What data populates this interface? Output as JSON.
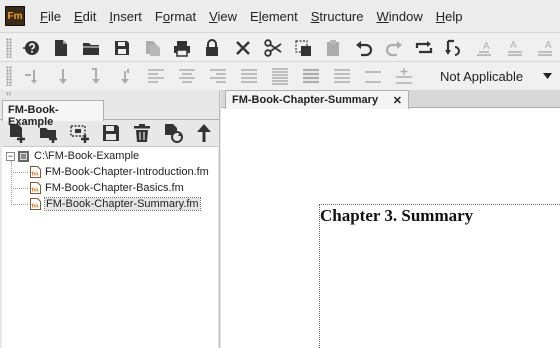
{
  "app": {
    "logo_text": "Fm"
  },
  "menu": [
    "File",
    "Edit",
    "Insert",
    "Format",
    "View",
    "Element",
    "Structure",
    "Window",
    "Help"
  ],
  "menu_underline": [
    "F",
    "E",
    "I",
    "o",
    "V",
    "l",
    "S",
    "W",
    "H"
  ],
  "toolbar1_icons": [
    "help-icon",
    "new-file-icon",
    "open-folder-icon",
    "save-icon",
    "copy-file-icon",
    "print-icon",
    "lock-icon",
    "close-x-icon",
    "cut-icon",
    "copy-selection-icon",
    "paste-icon",
    "undo-icon",
    "redo-icon",
    "repeat-icon",
    "reverse-sort-icon",
    "text-style-a-icon",
    "text-style-a2-icon",
    "text-style-a3-icon"
  ],
  "toolbar2_icons": [
    "element-first-icon",
    "element-down-icon",
    "element-down2-icon",
    "element-down3-icon",
    "align-left-icon",
    "align-center-icon",
    "align-right-icon",
    "justify-icon",
    "paragraph-lines-icon",
    "list-icon",
    "list-indent-icon",
    "lines-icon",
    "plus-lines-icon"
  ],
  "toolbar2": {
    "dropdown_value": "Not Applicable"
  },
  "left_panel": {
    "tab_label": "FM-Book-Example",
    "tool_icons": [
      "add-file-icon",
      "add-folder-icon",
      "add-selection-icon",
      "save-book-icon",
      "delete-icon",
      "update-book-icon",
      "move-up-icon"
    ],
    "tree": {
      "root_label": "C:\\FM-Book-Example",
      "expander": "−",
      "children": [
        "FM-Book-Chapter-Introduction.fm",
        "FM-Book-Chapter-Basics.fm",
        "FM-Book-Chapter-Summary.fm"
      ]
    }
  },
  "document": {
    "tab_label": "FM-Book-Chapter-Summary",
    "tab_close": "✕",
    "chapter_title": "Chapter 3. Summary"
  },
  "colors": {
    "logo_bg": "#3a2a1a",
    "logo_fg": "#f0a030",
    "icon": "#333333"
  }
}
